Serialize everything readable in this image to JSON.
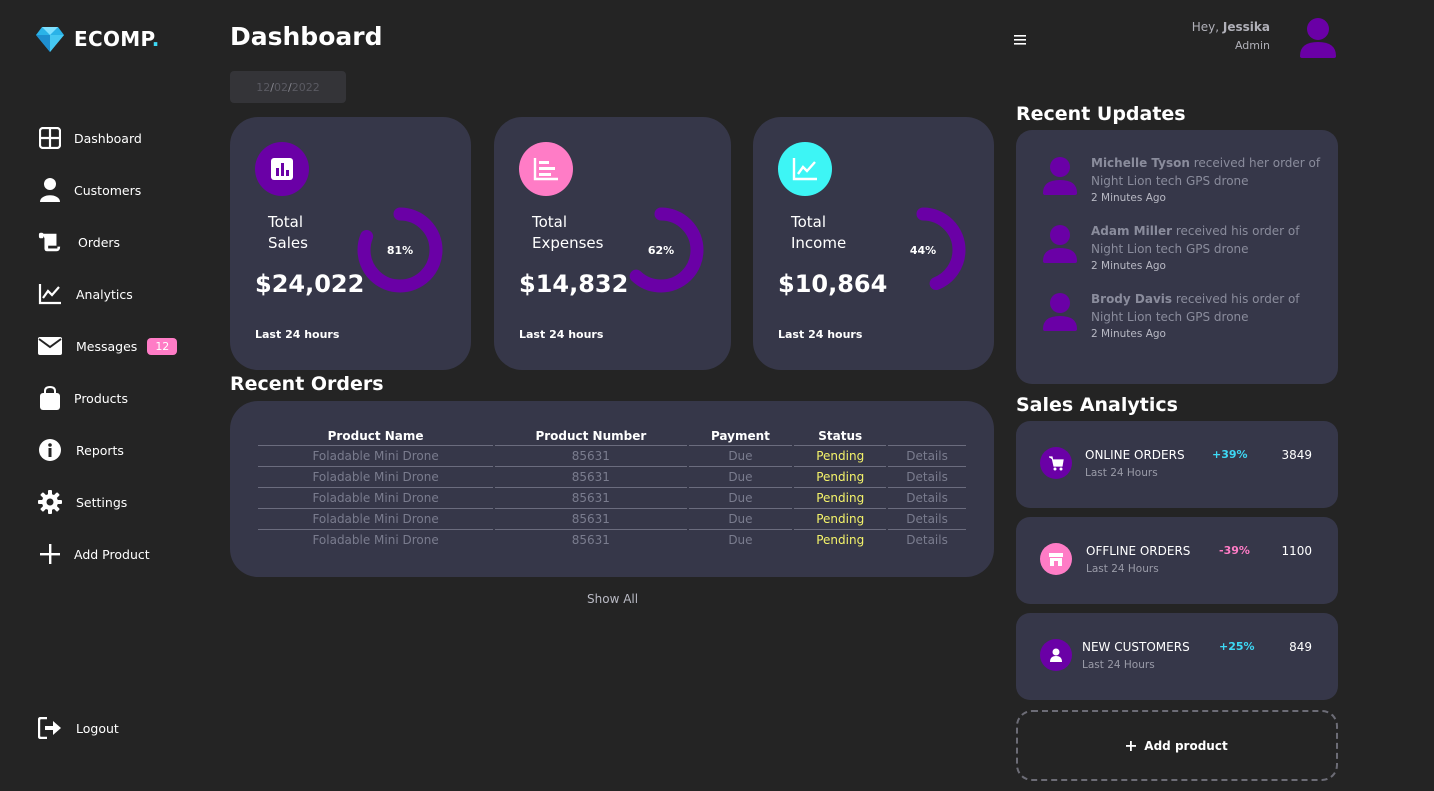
{
  "brand": {
    "name": "ECOMP",
    "dot": ".",
    "accent": "#3dd9f5"
  },
  "sidebar": {
    "items": [
      {
        "label": "Dashboard",
        "icon": "grid-icon"
      },
      {
        "label": "Customers",
        "icon": "user-icon"
      },
      {
        "label": "Orders",
        "icon": "scroll-icon"
      },
      {
        "label": "Analytics",
        "icon": "chart-line-icon"
      },
      {
        "label": "Messages",
        "icon": "envelope-icon",
        "badge": "12"
      },
      {
        "label": "Products",
        "icon": "bag-icon"
      },
      {
        "label": "Reports",
        "icon": "info-icon"
      },
      {
        "label": "Settings",
        "icon": "gear-icon"
      },
      {
        "label": "Add Product",
        "icon": "plus-icon"
      }
    ],
    "logout": "Logout"
  },
  "header": {
    "title": "Dashboard",
    "date": {
      "d": "12",
      "m": "02",
      "y": "2022"
    }
  },
  "user": {
    "greeting": "Hey, ",
    "name": "Jessika",
    "role": "Admin"
  },
  "stats": [
    {
      "title1": "Total",
      "title2": "Sales",
      "value": "$24,022",
      "percent": "81%",
      "percent_value": 81,
      "footer": "Last 24 hours",
      "icon_color": "#6a00a6",
      "icon": "bar-chart-icon"
    },
    {
      "title1": "Total",
      "title2": "Expenses",
      "value": "$14,832",
      "percent": "62%",
      "percent_value": 62,
      "footer": "Last 24 hours",
      "icon_color": "#ff7cc6",
      "icon": "list-chart-icon"
    },
    {
      "title1": "Total",
      "title2": "Income",
      "value": "$10,864",
      "percent": "44%",
      "percent_value": 44,
      "footer": "Last 24 hours",
      "icon_color": "#3df5f5",
      "icon": "trend-icon"
    }
  ],
  "recent_orders": {
    "title": "Recent Orders",
    "columns": [
      "Product Name",
      "Product Number",
      "Payment",
      "Status",
      ""
    ],
    "rows": [
      [
        "Foladable Mini Drone",
        "85631",
        "Due",
        "Pending",
        "Details"
      ],
      [
        "Foladable Mini Drone",
        "85631",
        "Due",
        "Pending",
        "Details"
      ],
      [
        "Foladable Mini Drone",
        "85631",
        "Due",
        "Pending",
        "Details"
      ],
      [
        "Foladable Mini Drone",
        "85631",
        "Due",
        "Pending",
        "Details"
      ],
      [
        "Foladable Mini Drone",
        "85631",
        "Due",
        "Pending",
        "Details"
      ]
    ],
    "show_all": "Show All"
  },
  "recent_updates": {
    "title": "Recent Updates",
    "items": [
      {
        "name": "Michelle Tyson",
        "text": " received her order of Night Lion tech GPS drone",
        "time": "2 Minutes Ago"
      },
      {
        "name": "Adam Miller",
        "text": " received his order of Night Lion tech GPS drone",
        "time": "2 Minutes Ago"
      },
      {
        "name": "Brody Davis",
        "text": " received his order of Night Lion tech GPS drone",
        "time": "2 Minutes Ago"
      }
    ]
  },
  "sales_analytics": {
    "title": "Sales Analytics",
    "items": [
      {
        "label": "ONLINE ORDERS",
        "sub": "Last 24 Hours",
        "pct": "+39%",
        "value": "3849",
        "color": "#6a00a6",
        "pct_color": "#3dd9f5",
        "icon": "cart-icon"
      },
      {
        "label": "OFFLINE ORDERS",
        "sub": "Last 24 Hours",
        "pct": "-39%",
        "value": "1100",
        "color": "#ff7cc6",
        "pct_color": "#ff7cc6",
        "icon": "store-icon"
      },
      {
        "label": "NEW CUSTOMERS",
        "sub": "Last 24 Hours",
        "pct": "+25%",
        "value": "849",
        "color": "#6a00a6",
        "pct_color": "#3dd9f5",
        "icon": "user-icon"
      }
    ],
    "add_product": "Add product"
  },
  "colors": {
    "ring": "#6a00a6",
    "card_bg": "#363749",
    "pending": "#f4f36a"
  }
}
